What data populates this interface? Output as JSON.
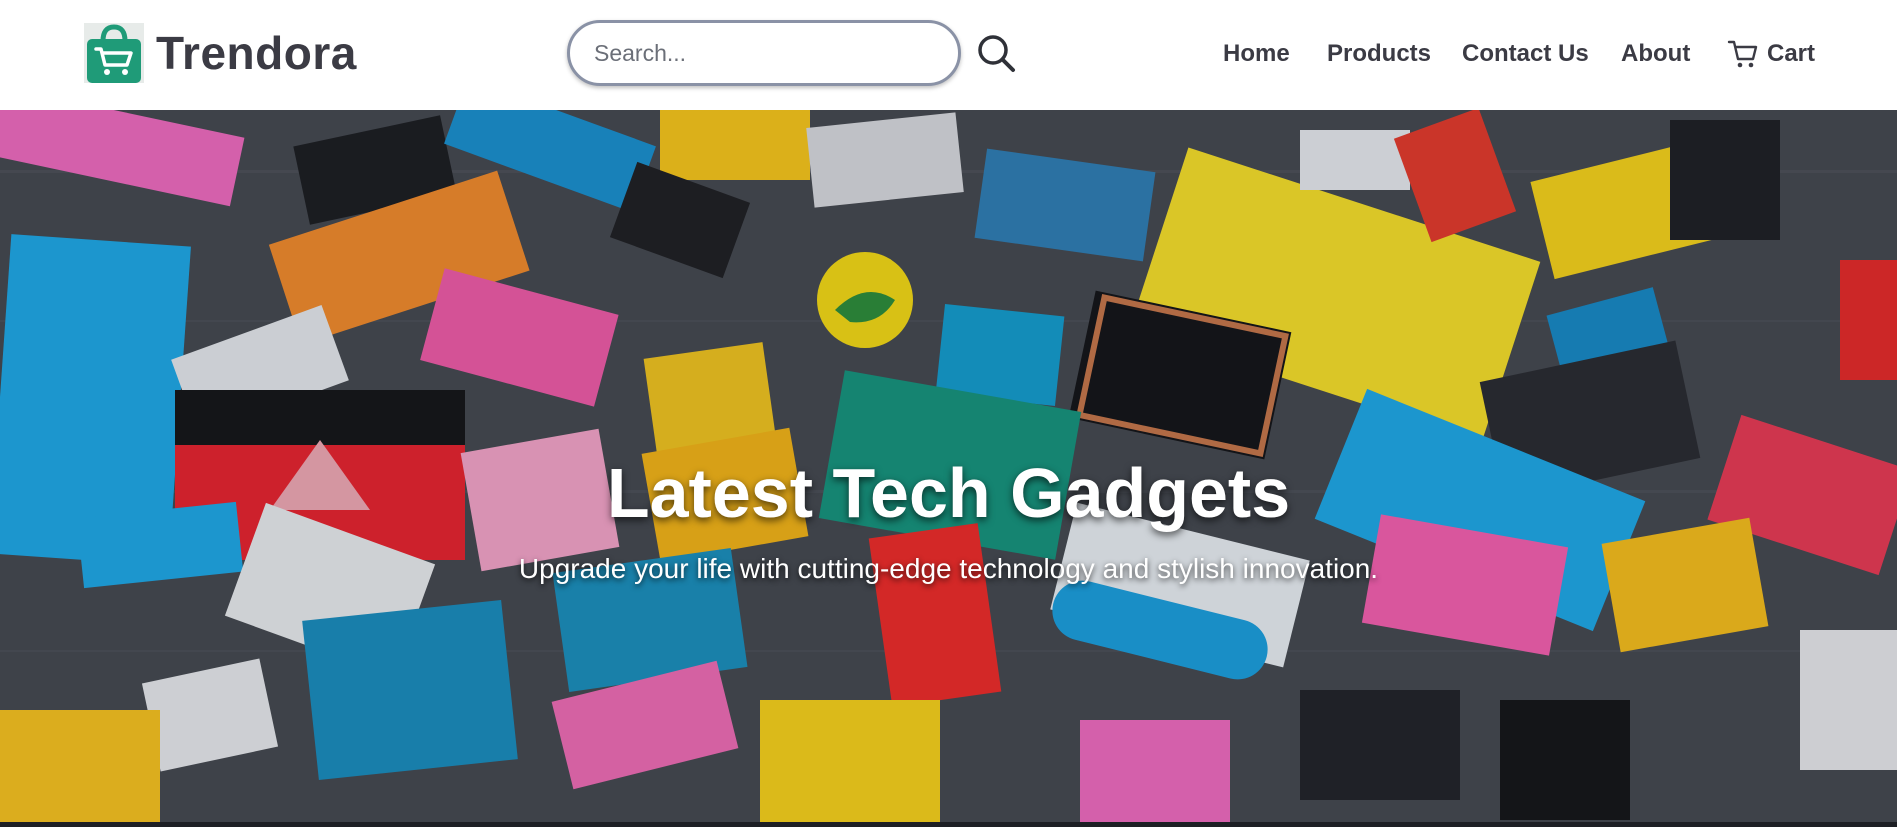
{
  "header": {
    "brand_name": "Trendora",
    "logo_icon": "shopping-bag-cart-icon",
    "search": {
      "placeholder": "Search...",
      "value": "",
      "icon": "search-icon"
    },
    "nav": {
      "home": "Home",
      "products": "Products",
      "contact": "Contact Us",
      "about": "About",
      "cart": "Cart",
      "cart_icon": "shopping-cart-icon"
    }
  },
  "hero": {
    "title": "Latest Tech Gadgets",
    "subtitle": "Upgrade your life with cutting-edge technology and stylish innovation."
  },
  "colors": {
    "brand_green": "#1f9b78",
    "text_dark": "#3b3b44",
    "search_border": "#8a92a6"
  }
}
